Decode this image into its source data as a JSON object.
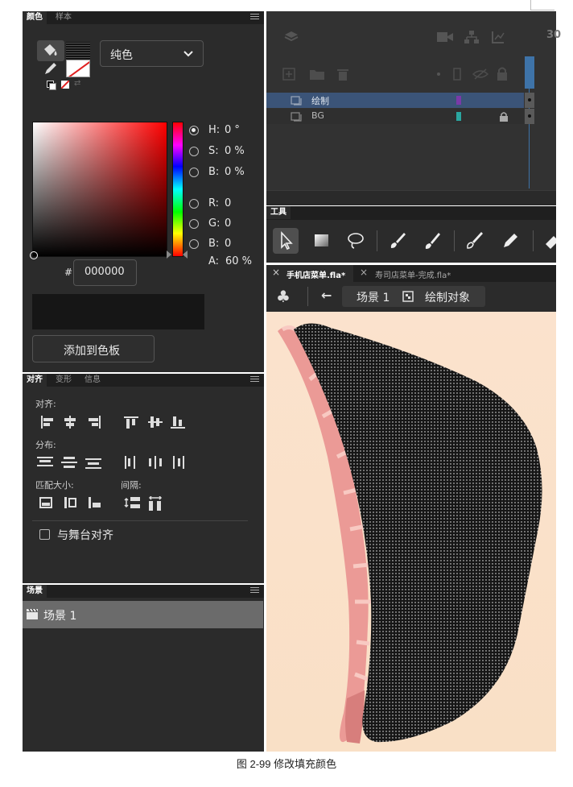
{
  "color_panel": {
    "tabs": [
      "颜色",
      "样本"
    ],
    "fill_type": "纯色",
    "hsb": [
      {
        "label": "H:",
        "value": "0 °"
      },
      {
        "label": "S:",
        "value": "0 %"
      },
      {
        "label": "B:",
        "value": "0 %"
      }
    ],
    "rgb": [
      {
        "label": "R:",
        "value": "0"
      },
      {
        "label": "G:",
        "value": "0"
      },
      {
        "label": "B:",
        "value": "0"
      }
    ],
    "alpha_label": "A:",
    "alpha_value": "60 %",
    "hex_prefix": "#",
    "hex_value": "000000",
    "add_button": "添加到色板",
    "preview_color": "#161616"
  },
  "align_panel": {
    "tabs": [
      "对齐",
      "变形",
      "信息"
    ],
    "align_label": "对齐:",
    "distribute_label": "分布:",
    "match_size_label": "匹配大小:",
    "spacing_label": "间隔:",
    "stage_align": "与舞台对齐"
  },
  "scene_panel": {
    "tab": "场景",
    "scene_item": "场景 1"
  },
  "timeline": {
    "frame_number": "30",
    "layers": [
      {
        "name": "绘制",
        "color": "#7a3aa8",
        "selected": true
      },
      {
        "name": "BG",
        "color": "#2aa6a0",
        "selected": false,
        "locked": true
      }
    ]
  },
  "tools_panel": {
    "title": "工具"
  },
  "document": {
    "tabs": [
      {
        "label": "手机店菜单.fla*",
        "active": true
      },
      {
        "label": "寿司店菜单-完成.fla*",
        "active": false
      }
    ],
    "breadcrumb_scene": "场景 1",
    "breadcrumb_object": "绘制对象"
  },
  "caption": "图 2-99  修改填充颜色"
}
